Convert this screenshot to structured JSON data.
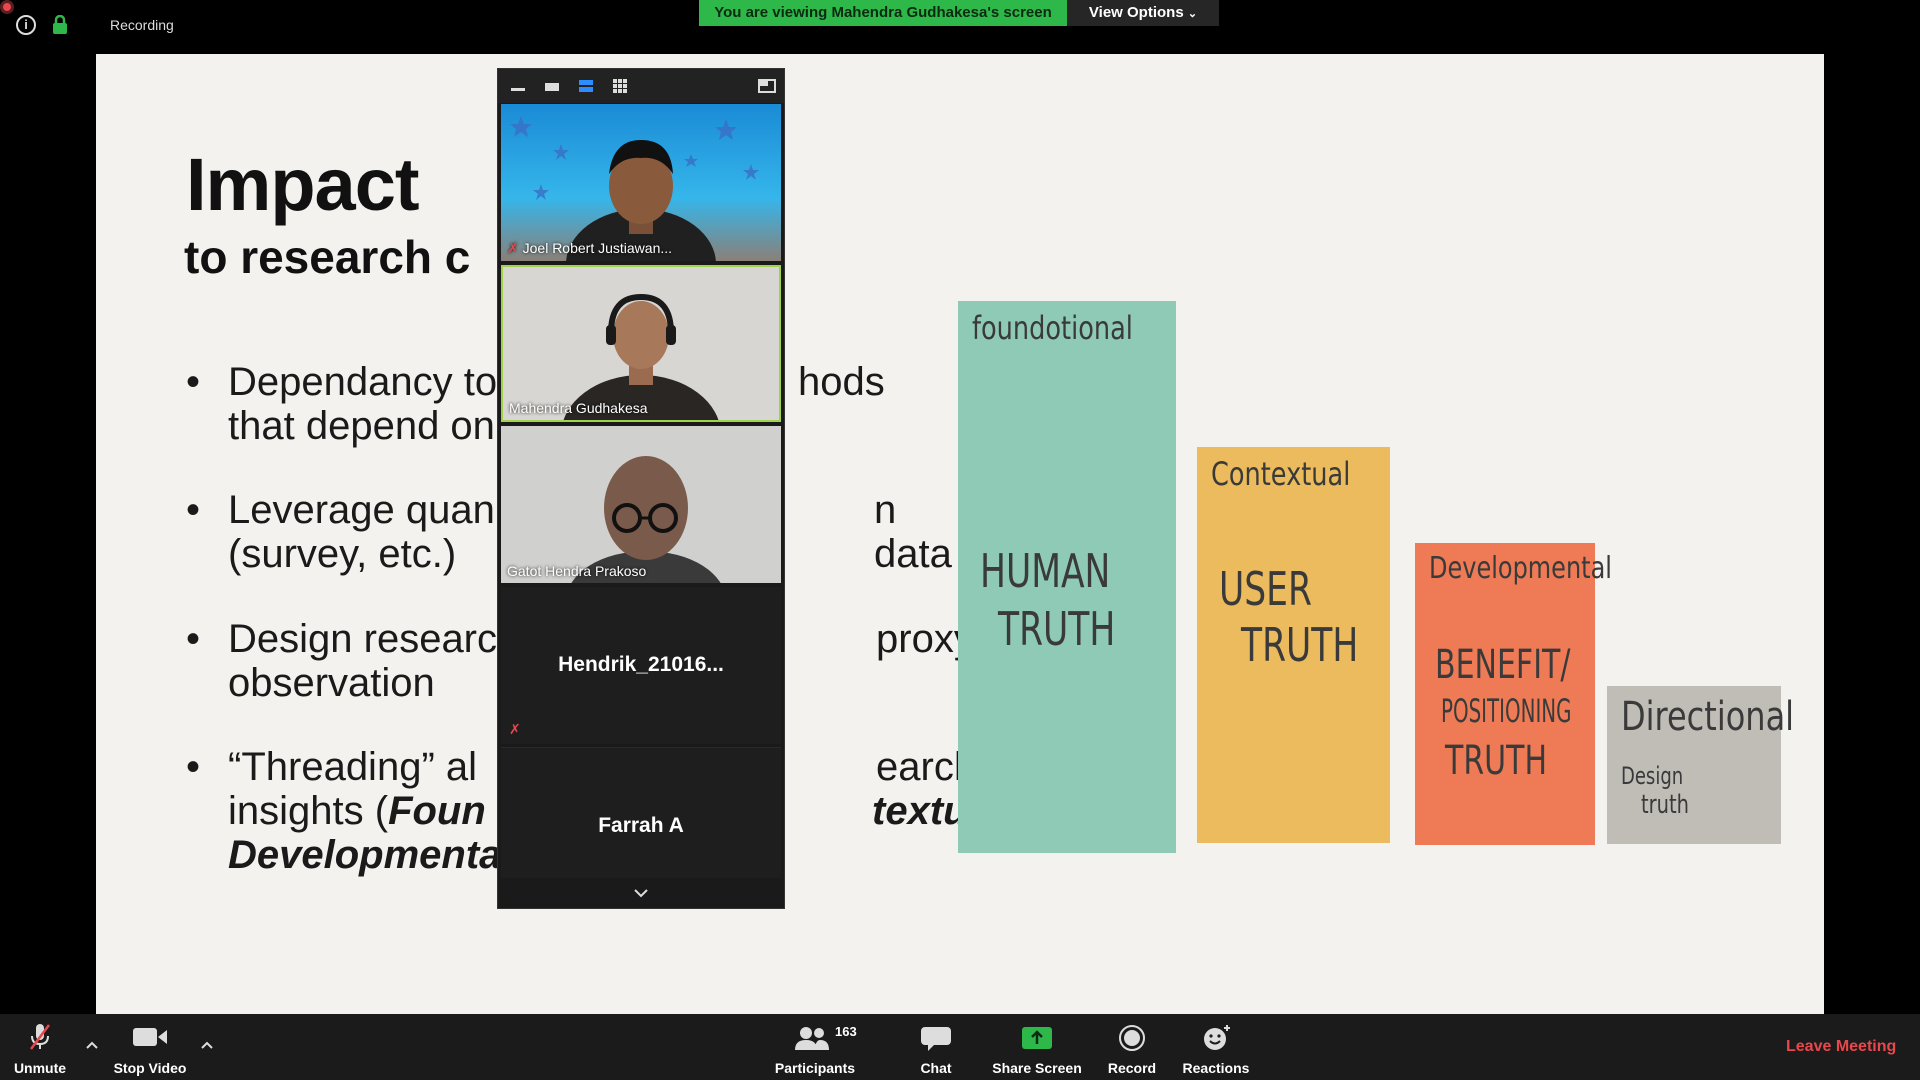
{
  "topbar": {
    "recording_label": "Recording",
    "viewing_banner": "You are viewing Mahendra Gudhakesa's screen",
    "view_options_label": "View Options"
  },
  "slide": {
    "title": "Impact",
    "subtitle": "to research c",
    "bullets": [
      {
        "line1": "Dependancy to",
        "line1_right": "hods",
        "line2": "that depend on"
      },
      {
        "line1": "Leverage quan",
        "line1_right": "n data",
        "line2": "(survey, etc.)"
      },
      {
        "line1": "Design researc",
        "line1_right": "proxy”",
        "line2": "observation"
      },
      {
        "line1": "“Threading” al",
        "line1_right": "earch",
        "line2_a": "insights (",
        "line2_b": "Foun",
        "line2_c": "textual,",
        "line3": "Developmenta"
      }
    ],
    "stacks": [
      {
        "head": "foundotional",
        "body1": "HUMAN",
        "body2": "TRUTH",
        "color": "#8ecab5"
      },
      {
        "head": "Contextual",
        "body1": "USER",
        "body2": "TRUTH",
        "color": "#ebbb5d"
      },
      {
        "head": "Developmental",
        "body1": "BENEFIT/",
        "body2": "POSITIONING",
        "body3": "TRUTH",
        "color": "#ee7b55"
      },
      {
        "head": "Directional",
        "body1": "Design",
        "body2": "truth",
        "color": "#c0bdb7"
      }
    ]
  },
  "participants": {
    "tiles": [
      {
        "name": "Joel Robert Justiawan..."
      },
      {
        "name": "Mahendra Gudhakesa"
      },
      {
        "name": "Gatot Hendra Prakoso"
      }
    ],
    "no_video": [
      {
        "name": "Hendrik_21016..."
      },
      {
        "name": "Farrah A"
      }
    ]
  },
  "toolbar": {
    "unmute": "Unmute",
    "stop_video": "Stop Video",
    "participants": "Participants",
    "participants_count": "163",
    "chat": "Chat",
    "share_screen": "Share Screen",
    "record": "Record",
    "reactions": "Reactions",
    "leave": "Leave Meeting"
  },
  "colors": {
    "banner_green": "#2fb84a",
    "leave_red": "#e8474c",
    "share_green": "#2fb84a"
  }
}
